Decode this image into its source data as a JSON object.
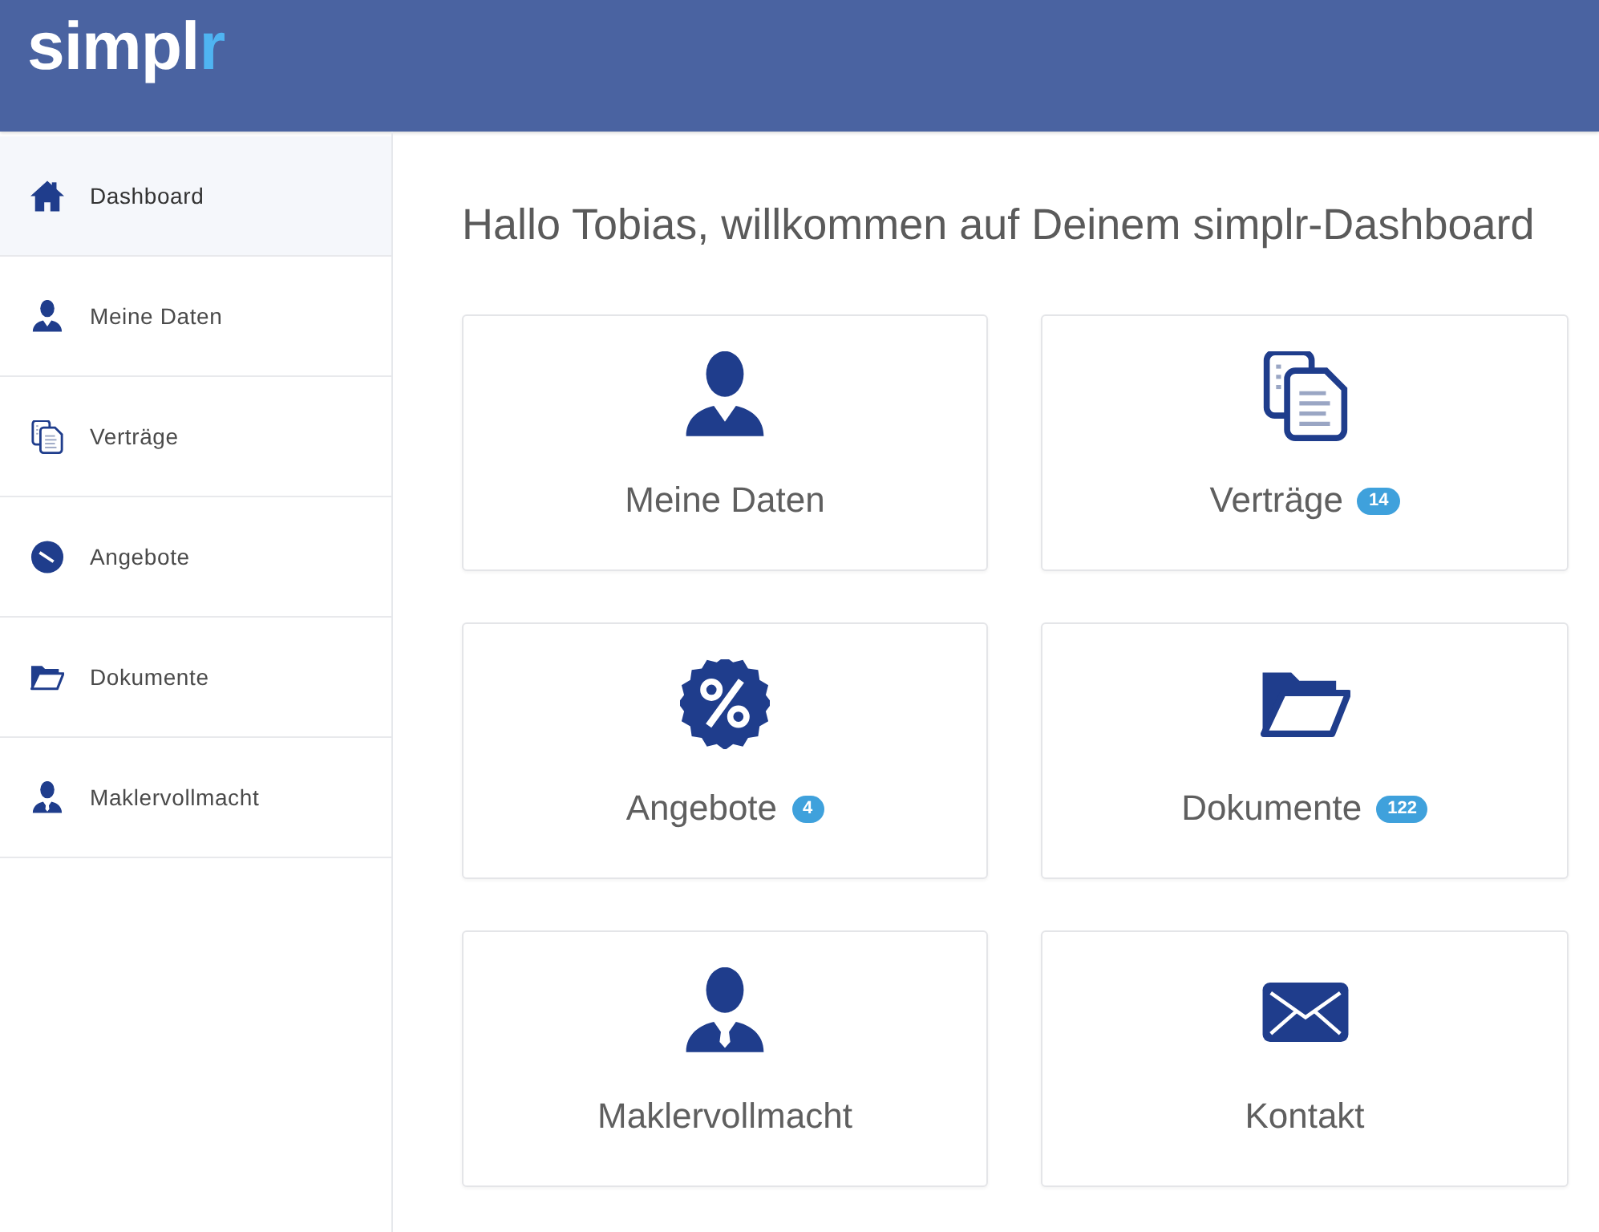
{
  "header": {
    "logo": {
      "main": "simpl",
      "accent": "r"
    }
  },
  "sidebar": {
    "items": [
      {
        "label": "Dashboard",
        "selected": true
      },
      {
        "label": "Meine Daten",
        "selected": false
      },
      {
        "label": "Verträge",
        "selected": false
      },
      {
        "label": "Angebote",
        "selected": false
      },
      {
        "label": "Dokumente",
        "selected": false
      },
      {
        "label": "Maklervollmacht",
        "selected": false
      }
    ]
  },
  "main": {
    "greeting": "Hallo Tobias, willkommen auf Deinem simplr-Dashboard",
    "tiles": [
      {
        "label": "Meine Daten"
      },
      {
        "label": "Verträge",
        "badge": "14"
      },
      {
        "label": "Angebote",
        "badge": "4"
      },
      {
        "label": "Dokumente",
        "badge": "122"
      },
      {
        "label": "Maklervollmacht"
      },
      {
        "label": "Kontakt"
      }
    ]
  }
}
